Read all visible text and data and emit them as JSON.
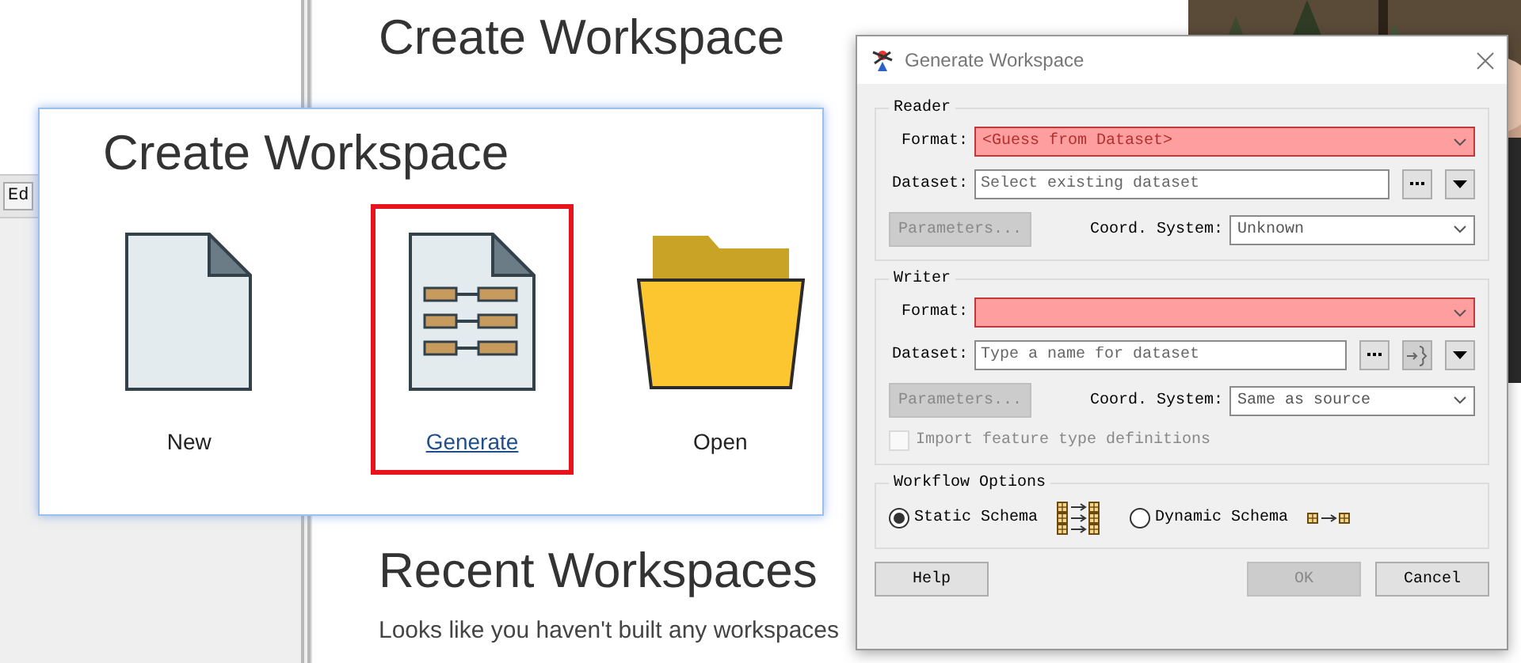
{
  "page": {
    "toolbar_tab": "Ed",
    "heading": "Create Workspace",
    "recent_heading": "Recent Workspaces",
    "recent_lines": [
      "Looks like you haven't built any workspaces"
    ]
  },
  "create_card": {
    "title": "Create Workspace",
    "options": [
      {
        "label": "New",
        "kind": "new",
        "selected": false
      },
      {
        "label": "Generate",
        "kind": "generate",
        "selected": true
      },
      {
        "label": "Open",
        "kind": "open",
        "selected": false
      }
    ]
  },
  "dialog": {
    "title": "Generate Workspace",
    "sections": [
      {
        "legend": "Reader",
        "kind": "reader",
        "format": {
          "label": "Format:",
          "value": "<Guess from Dataset>",
          "invalid": true
        },
        "dataset": {
          "label": "Dataset:",
          "placeholder": "Select existing dataset"
        },
        "parameters": {
          "label": "Parameters...",
          "disabled": true
        },
        "coord": {
          "label": "Coord. System:",
          "value": "Unknown"
        }
      },
      {
        "legend": "Writer",
        "kind": "writer",
        "format": {
          "label": "Format:",
          "invalid": true
        },
        "dataset": {
          "label": "Dataset:",
          "placeholder": "Type a name for dataset"
        },
        "parameters": {
          "label": "Parameters...",
          "disabled": true
        },
        "coord": {
          "label": "Coord. System:",
          "value": "Same as source"
        },
        "import": {
          "label": "Import feature type definitions",
          "checked": false,
          "disabled": true
        }
      }
    ],
    "workflow": {
      "legend": "Workflow Options",
      "options": [
        {
          "label": "Static Schema",
          "kind": "static",
          "selected": true
        },
        {
          "label": "Dynamic Schema",
          "kind": "dynamic",
          "selected": false
        }
      ]
    },
    "buttons": [
      {
        "label": "Help",
        "kind": "help",
        "disabled": false
      },
      {
        "label": "OK",
        "kind": "ok",
        "disabled": true
      },
      {
        "label": "Cancel",
        "kind": "cancel",
        "disabled": false
      }
    ]
  }
}
